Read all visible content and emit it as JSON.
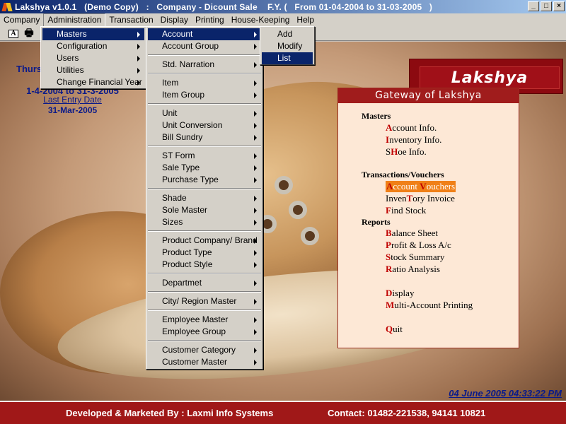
{
  "window": {
    "title": "Lakshya v1.0.1   (Demo Copy)   :   Company - Dicount Sale    F.Y. (   From 01-04-2004 to 31-03-2005   )",
    "buttons": [
      "_",
      "□",
      "×"
    ]
  },
  "menubar": [
    "Company",
    "Administration",
    "Transaction",
    "Display",
    "Printing",
    "House-Keeping",
    "Help"
  ],
  "toolbar": {
    "tool1": "A",
    "tool2": "🖶"
  },
  "admin_menu": [
    "Masters",
    "Configuration",
    "Users",
    "Utilities",
    "Change Financial Year"
  ],
  "masters_menu": {
    "groups": [
      [
        "Account",
        "Account Group"
      ],
      [
        "Std. Narration"
      ],
      [
        "Item",
        "Item Group"
      ],
      [
        "Unit",
        "Unit Conversion",
        "Bill Sundry"
      ],
      [
        "ST Form",
        "Sale Type",
        "Purchase Type"
      ],
      [
        "Shade",
        "Sole Master",
        "Sizes"
      ],
      [
        "Product Company/ Brand",
        "Product Type",
        "Product Style"
      ],
      [
        "Departmet"
      ],
      [
        "City/ Region Master"
      ],
      [
        "Employee Master",
        "Employee Group"
      ],
      [
        "Customer Category",
        "Customer Master"
      ]
    ]
  },
  "account_menu": [
    "Add",
    "Modify",
    "List"
  ],
  "left_info": {
    "day": "Thurs",
    "fy_range": "1-4-2004 to 31-3-2005",
    "last_entry_label": "Last Entry Date",
    "last_entry_date": "31-Mar-2005"
  },
  "brand": "Lakshya",
  "gateway": {
    "title": "Gateway of Lakshya",
    "sections": {
      "masters": "Masters",
      "transactions": "Transactions/Vouchers",
      "reports": "Reports"
    },
    "items": {
      "account_info": {
        "hk": "A",
        "rest": "ccount Info."
      },
      "inventory_info": {
        "hk": "I",
        "rest": "nventory Info."
      },
      "shoe_info": {
        "pre": "S",
        "hk": "H",
        "rest": "oe Info."
      },
      "account_vouchers": {
        "hk": "A",
        "mid": "ccount ",
        "hk2": "V",
        "rest": "ouchers"
      },
      "inventory_invoice": {
        "pre": "Inven",
        "hk": "T",
        "rest": "ory Invoice"
      },
      "find_stock": {
        "hk": "F",
        "rest": "ind Stock"
      },
      "balance_sheet": {
        "hk": "B",
        "rest": "alance Sheet"
      },
      "profit_loss": {
        "hk": "P",
        "rest": "rofit & Loss A/c"
      },
      "stock_summary": {
        "hk": "S",
        "rest": "tock Summary"
      },
      "ratio_analysis": {
        "hk": "R",
        "rest": "atio Analysis"
      },
      "display": {
        "hk": "D",
        "rest": "isplay"
      },
      "multi_print": {
        "hk": "M",
        "rest": "ulti-Account Printing"
      },
      "quit": {
        "hk": "Q",
        "rest": "uit"
      }
    }
  },
  "datetime": "04 June 2005  04:33:22 PM",
  "footer": {
    "developer": "Developed & Marketed By : Laxmi Info Systems",
    "contact": "Contact: 01482-221538, 94141 10821"
  }
}
